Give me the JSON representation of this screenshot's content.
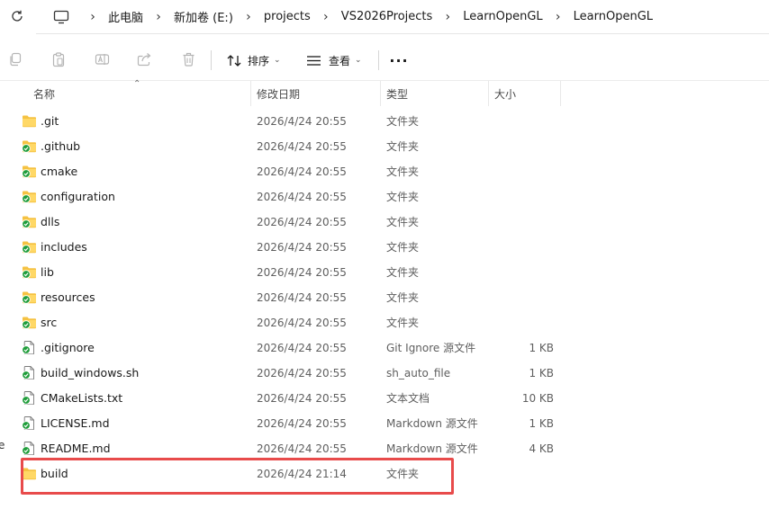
{
  "breadcrumbs": [
    "此电脑",
    "新加卷 (E:)",
    "projects",
    "VS2026Projects",
    "LearnOpenGL",
    "LearnOpenGL"
  ],
  "toolbar": {
    "sort_label": "排序",
    "view_label": "查看",
    "more_label": "···"
  },
  "columns": {
    "name": "名称",
    "date": "修改日期",
    "type": "类型",
    "size": "大小"
  },
  "files": [
    {
      "name": ".git",
      "date": "2026/4/24 20:55",
      "type": "文件夹",
      "size": "",
      "icon": "folder-plain-icon"
    },
    {
      "name": ".github",
      "date": "2026/4/24 20:55",
      "type": "文件夹",
      "size": "",
      "icon": "folder-synced-icon"
    },
    {
      "name": "cmake",
      "date": "2026/4/24 20:55",
      "type": "文件夹",
      "size": "",
      "icon": "folder-synced-icon"
    },
    {
      "name": "configuration",
      "date": "2026/4/24 20:55",
      "type": "文件夹",
      "size": "",
      "icon": "folder-synced-icon"
    },
    {
      "name": "dlls",
      "date": "2026/4/24 20:55",
      "type": "文件夹",
      "size": "",
      "icon": "folder-synced-icon"
    },
    {
      "name": "includes",
      "date": "2026/4/24 20:55",
      "type": "文件夹",
      "size": "",
      "icon": "folder-synced-icon"
    },
    {
      "name": "lib",
      "date": "2026/4/24 20:55",
      "type": "文件夹",
      "size": "",
      "icon": "folder-synced-icon"
    },
    {
      "name": "resources",
      "date": "2026/4/24 20:55",
      "type": "文件夹",
      "size": "",
      "icon": "folder-synced-icon"
    },
    {
      "name": "src",
      "date": "2026/4/24 20:55",
      "type": "文件夹",
      "size": "",
      "icon": "folder-synced-icon"
    },
    {
      "name": ".gitignore",
      "date": "2026/4/24 20:55",
      "type": "Git Ignore 源文件",
      "size": "1 KB",
      "icon": "file-synced-icon"
    },
    {
      "name": "build_windows.sh",
      "date": "2026/4/24 20:55",
      "type": "sh_auto_file",
      "size": "1 KB",
      "icon": "file-synced-icon"
    },
    {
      "name": "CMakeLists.txt",
      "date": "2026/4/24 20:55",
      "type": "文本文档",
      "size": "10 KB",
      "icon": "file-synced-icon"
    },
    {
      "name": "LICENSE.md",
      "date": "2026/4/24 20:55",
      "type": "Markdown 源文件",
      "size": "1 KB",
      "icon": "file-synced-icon"
    },
    {
      "name": "README.md",
      "date": "2026/4/24 20:55",
      "type": "Markdown 源文件",
      "size": "4 KB",
      "icon": "file-synced-icon"
    },
    {
      "name": "build",
      "date": "2026/4/24 21:14",
      "type": "文件夹",
      "size": "",
      "icon": "folder-plain-icon"
    }
  ],
  "colors": {
    "folder": "#f5c242",
    "folder_light": "#ffd866",
    "sync_green": "#1f9d3a",
    "highlight_border": "#e84b4b"
  },
  "edge_text": "e"
}
